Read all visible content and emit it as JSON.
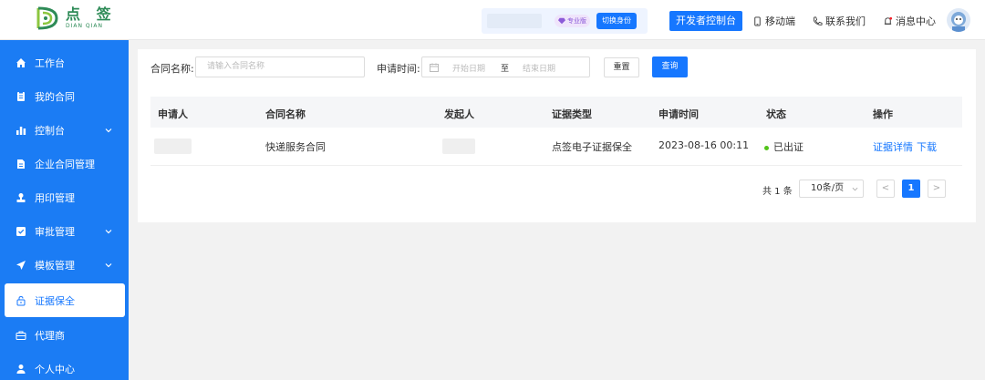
{
  "header": {
    "logo_cn": "点 签",
    "logo_en": "DIAN QIAN",
    "pro_badge": "专业版",
    "switch_identity": "切换身份",
    "dev_console": "开发者控制台",
    "mobile": "移动端",
    "contact": "联系我们",
    "messages": "消息中心"
  },
  "sidebar": {
    "items": [
      {
        "label": "工作台",
        "icon": "home-icon"
      },
      {
        "label": "我的合同",
        "icon": "contract-icon"
      },
      {
        "label": "控制台",
        "icon": "bar-chart-icon",
        "has_children": true
      },
      {
        "label": "企业合同管理",
        "icon": "document-icon"
      },
      {
        "label": "用印管理",
        "icon": "stamp-icon"
      },
      {
        "label": "审批管理",
        "icon": "approval-icon",
        "has_children": true
      },
      {
        "label": "模板管理",
        "icon": "send-icon",
        "has_children": true
      },
      {
        "label": "证据保全",
        "icon": "lock-icon",
        "active": true
      },
      {
        "label": "代理商",
        "icon": "briefcase-icon"
      },
      {
        "label": "个人中心",
        "icon": "user-icon"
      }
    ]
  },
  "filters": {
    "contract_name_label": "合同名称:",
    "contract_name_placeholder": "请输入合同名称",
    "apply_time_label": "申请时间:",
    "start_date_placeholder": "开始日期",
    "date_separator": "至",
    "end_date_placeholder": "结束日期",
    "reset": "重置",
    "query": "查询"
  },
  "table": {
    "columns": [
      "申请人",
      "合同名称",
      "发起人",
      "证据类型",
      "申请时间",
      "状态",
      "操作"
    ],
    "rows": [
      {
        "applicant": "",
        "contract_name": "快递服务合同",
        "initiator": "",
        "evidence_type": "点签电子证据保全",
        "apply_time": "2023-08-16 00:11",
        "status": "已出证",
        "action_detail": "证据详情",
        "action_download": "下载"
      }
    ]
  },
  "pagination": {
    "total": "共 1 条",
    "page_size": "10条/页",
    "current_page": "1",
    "prev": "<",
    "next": ">"
  },
  "colors": {
    "primary": "#1677ff",
    "sidebar": "#1b7cf4",
    "status_ok": "#52c41a",
    "logo_green": "#2e8b57"
  }
}
